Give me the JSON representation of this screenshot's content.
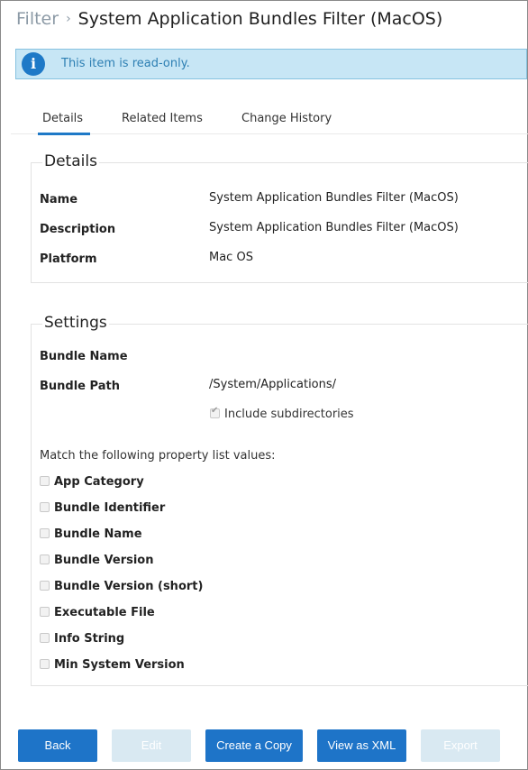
{
  "breadcrumb": {
    "parent": "Filter",
    "separator": "›",
    "title": "System Application Bundles Filter (MacOS)"
  },
  "banner": {
    "icon": "info-icon",
    "message": "This item is read-only."
  },
  "tabs": [
    {
      "label": "Details",
      "active": true
    },
    {
      "label": "Related Items",
      "active": false
    },
    {
      "label": "Change History",
      "active": false
    }
  ],
  "details": {
    "title": "Details",
    "name_label": "Name",
    "name_value": "System Application Bundles Filter (MacOS)",
    "description_label": "Description",
    "description_value": "System Application Bundles Filter (MacOS)",
    "platform_label": "Platform",
    "platform_value": "Mac OS"
  },
  "settings": {
    "title": "Settings",
    "bundle_name_label": "Bundle Name",
    "bundle_name_value": "",
    "bundle_path_label": "Bundle Path",
    "bundle_path_value": "/System/Applications/",
    "include_subdirectories_label": "Include subdirectories",
    "include_subdirectories_checked": true,
    "match_intro": "Match the following property list values:",
    "properties": [
      {
        "label": "App Category",
        "checked": false
      },
      {
        "label": "Bundle Identifier",
        "checked": false
      },
      {
        "label": "Bundle Name",
        "checked": false
      },
      {
        "label": "Bundle Version",
        "checked": false
      },
      {
        "label": "Bundle Version (short)",
        "checked": false
      },
      {
        "label": "Executable File",
        "checked": false
      },
      {
        "label": "Info String",
        "checked": false
      },
      {
        "label": "Min System Version",
        "checked": false
      }
    ]
  },
  "buttons": {
    "back": "Back",
    "edit": "Edit",
    "create_copy": "Create a Copy",
    "view_xml": "View as XML",
    "export": "Export"
  },
  "colors": {
    "primary": "#1e74c8",
    "disabled": "#d9e9f2",
    "banner_bg": "#c7e6f5",
    "banner_text": "#2d7fb3"
  }
}
